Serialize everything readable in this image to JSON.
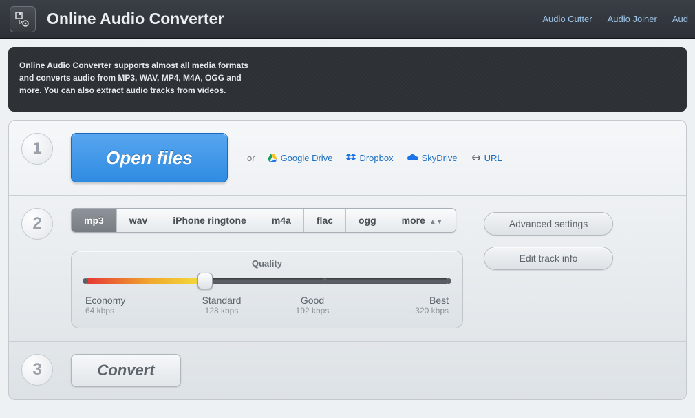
{
  "header": {
    "title": "Online Audio Converter",
    "links": [
      "Audio Cutter",
      "Audio Joiner",
      "Aud"
    ]
  },
  "description": "Online Audio Converter supports almost all media formats and converts audio from MP3, WAV, MP4, M4A, OGG and more. You can also extract audio tracks from videos.",
  "step1": {
    "number": "1",
    "open_label": "Open files",
    "or": "or",
    "sources": [
      {
        "name": "google-drive",
        "label": "Google Drive"
      },
      {
        "name": "dropbox",
        "label": "Dropbox"
      },
      {
        "name": "skydrive",
        "label": "SkyDrive"
      },
      {
        "name": "url",
        "label": "URL"
      }
    ]
  },
  "step2": {
    "number": "2",
    "tabs": [
      "mp3",
      "wav",
      "iPhone ringtone",
      "m4a",
      "flac",
      "ogg",
      "more"
    ],
    "active_tab": 0,
    "quality_title": "Quality",
    "quality_levels": [
      {
        "label": "Economy",
        "rate": "64 kbps"
      },
      {
        "label": "Standard",
        "rate": "128 kbps"
      },
      {
        "label": "Good",
        "rate": "192 kbps"
      },
      {
        "label": "Best",
        "rate": "320 kbps"
      }
    ],
    "advanced": "Advanced settings",
    "track_info": "Edit track info"
  },
  "step3": {
    "number": "3",
    "convert": "Convert"
  }
}
